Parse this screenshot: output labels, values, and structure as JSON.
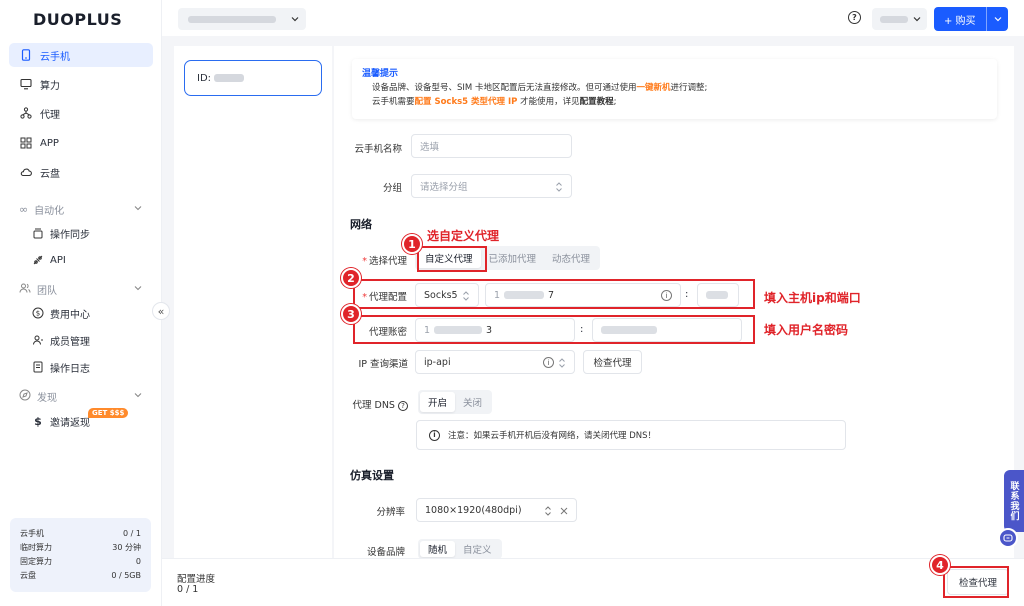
{
  "app": {
    "logo": "DUOPLUS"
  },
  "sidebar": {
    "items": [
      {
        "label": "云手机",
        "icon": "phone-icon"
      },
      {
        "label": "算力",
        "icon": "monitor-icon"
      },
      {
        "label": "代理",
        "icon": "network-icon"
      },
      {
        "label": "APP",
        "icon": "apps-grid-icon"
      },
      {
        "label": "云盘",
        "icon": "cloud-icon"
      }
    ],
    "groups": [
      {
        "label": "自动化",
        "icon": "infinity-icon",
        "children": [
          {
            "label": "操作同步",
            "icon": "sync-icon"
          },
          {
            "label": "API",
            "icon": "api-icon"
          }
        ]
      },
      {
        "label": "团队",
        "icon": "team-icon",
        "children": [
          {
            "label": "费用中心",
            "icon": "dollar-circle-icon"
          },
          {
            "label": "成员管理",
            "icon": "members-icon"
          },
          {
            "label": "操作日志",
            "icon": "log-icon"
          }
        ]
      },
      {
        "label": "发现",
        "icon": "compass-icon",
        "children": [
          {
            "label": "邀请返现",
            "icon": "dollar-icon"
          }
        ]
      }
    ],
    "invite_badge": "GET $$$",
    "collapse_glyph": "«",
    "usage": [
      {
        "label": "云手机",
        "value": "0 / 1"
      },
      {
        "label": "临时算力",
        "value": "30 分钟"
      },
      {
        "label": "固定算力",
        "value": "0"
      },
      {
        "label": "云盘",
        "value": "0 / 5GB"
      }
    ]
  },
  "topbar": {
    "help_glyph": "?",
    "buy_label": "+ 购买"
  },
  "device": {
    "id_label": "ID:"
  },
  "notice": {
    "title": "温馨提示",
    "line1_a": "设备品牌、设备型号、SIM 卡地区配置后无法直接修改。但可通过使用",
    "line1_b": "一键新机",
    "line1_c": "进行调整;",
    "line2_a": "云手机需要",
    "line2_b": "配置 Socks5 类型代理 IP",
    "line2_c": " 才能使用，详见",
    "line2_d": "配置教程",
    "line2_e": ";"
  },
  "form": {
    "name_label": "云手机名称",
    "name_placeholder": "选填",
    "group_label": "分组",
    "group_placeholder": "请选择分组",
    "network_title": "网络",
    "proxy_select_label": "选择代理",
    "proxy_options": [
      "自定义代理",
      "已添加代理",
      "动态代理"
    ],
    "proxy_config_label": "代理配置",
    "proxy_type": "Socks5",
    "host_suffix": "7",
    "host_prefix": "1",
    "colon": ":",
    "proxy_account_label": "代理账密",
    "user_prefix": "1",
    "user_suffix": "3",
    "ip_channel_label": "IP 查询渠道",
    "ip_channel_value": "ip-api",
    "check_proxy": "检查代理",
    "dns_label": "代理 DNS",
    "dns_options": [
      "开启",
      "关闭"
    ],
    "dns_note": "注意：如果云手机开机后没有网络，请关闭代理 DNS！",
    "sim_title": "仿真设置",
    "resolution_label": "分辨率",
    "resolution_value": "1080×1920(480dpi)",
    "brand_label": "设备品牌",
    "brand_options": [
      "随机",
      "自定义"
    ]
  },
  "annotations": {
    "n1": "1",
    "t1": "选自定义代理",
    "n2": "2",
    "t2": "填入主机ip和端口",
    "n3": "3",
    "t3": "填入用户名密码",
    "n4": "4"
  },
  "bottom": {
    "progress_label": "配置进度",
    "progress_value": "0 / 1",
    "check_button": "检查代理"
  },
  "contact": {
    "label": "联系我们"
  },
  "colors": {
    "accent": "#1a5cff",
    "annotation": "#e0242a",
    "orange": "#ff7a1a"
  }
}
